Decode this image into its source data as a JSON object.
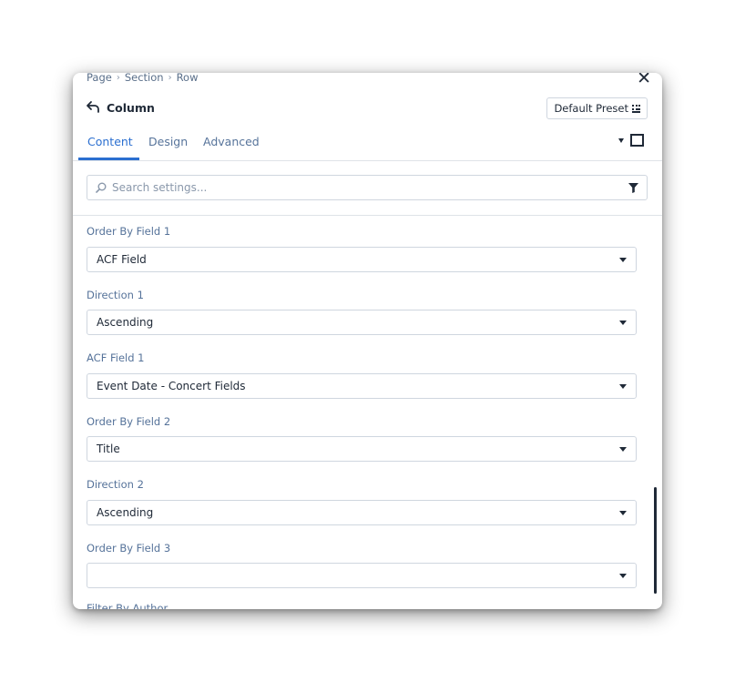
{
  "breadcrumb": [
    "Page",
    "Section",
    "Row"
  ],
  "header": {
    "title": "Column",
    "preset_label": "Default Preset"
  },
  "tabs": [
    {
      "label": "Content",
      "active": true
    },
    {
      "label": "Design",
      "active": false
    },
    {
      "label": "Advanced",
      "active": false
    }
  ],
  "search": {
    "placeholder": "Search settings..."
  },
  "fields": [
    {
      "label": "Order By Field 1",
      "value": "ACF Field"
    },
    {
      "label": "Direction 1",
      "value": "Ascending"
    },
    {
      "label": "ACF Field 1",
      "value": "Event Date - Concert Fields"
    },
    {
      "label": "Order By Field 2",
      "value": "Title"
    },
    {
      "label": "Direction 2",
      "value": "Ascending"
    },
    {
      "label": "Order By Field 3",
      "value": ""
    },
    {
      "label": "Filter By Author",
      "value": ""
    }
  ],
  "icons": {
    "close": "close-icon",
    "back": "back-arrow-icon",
    "preset": "preset-grid-icon",
    "search": "search-icon",
    "filter": "filter-icon"
  },
  "colors": {
    "accent": "#2b6fd0",
    "label": "#56739a",
    "text": "#1f2937"
  }
}
